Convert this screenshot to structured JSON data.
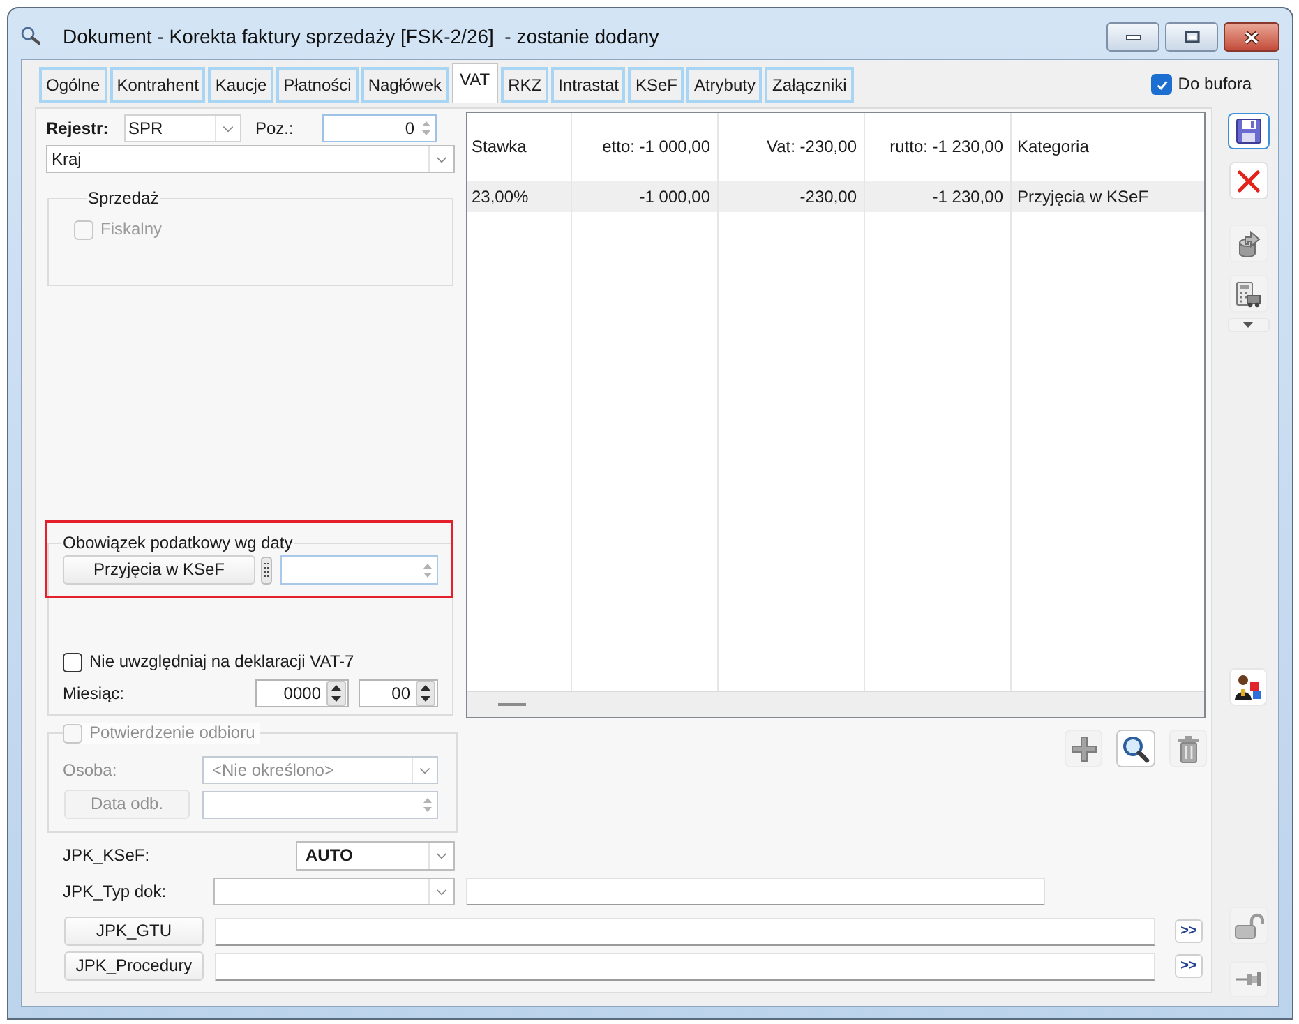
{
  "window": {
    "title": "Dokument - Korekta faktury sprzedaży [FSK-2/26]  - zostanie dodany"
  },
  "tabs": [
    {
      "label": "Ogólne",
      "selected": false
    },
    {
      "label": "Kontrahent",
      "selected": false
    },
    {
      "label": "Kaucje",
      "selected": false
    },
    {
      "label": "Płatności",
      "selected": false
    },
    {
      "label": "Nagłówek",
      "selected": false
    },
    {
      "label": "VAT",
      "selected": true
    },
    {
      "label": "RKZ",
      "selected": false
    },
    {
      "label": "Intrastat",
      "selected": false
    },
    {
      "label": "KSeF",
      "selected": false
    },
    {
      "label": "Atrybuty",
      "selected": false
    },
    {
      "label": "Załączniki",
      "selected": false
    }
  ],
  "do_bufora": {
    "label": "Do bufora",
    "checked": true
  },
  "rejestr": {
    "label": "Rejestr:",
    "value": "SPR"
  },
  "poz": {
    "label": "Poz.:",
    "value": "0"
  },
  "kraj": {
    "value": "Kraj"
  },
  "sprzedaz": {
    "title": "Sprzedaż",
    "fiskalny": {
      "label": "Fiskalny",
      "checked": false,
      "disabled": true
    }
  },
  "obowiazek_podatkowy": {
    "title": "Obowiązek podatkowy wg daty",
    "button": "Przyjęcia w KSeF",
    "highlighted": true
  },
  "pomin_vat7": {
    "label": "Nie uwzględniaj na deklaracji VAT-7",
    "checked": false
  },
  "miesiac": {
    "label": "Miesiąc:",
    "year": "0000",
    "month": "00"
  },
  "potwierdzenie_odbioru": {
    "label": "Potwierdzenie odbioru",
    "checked": false,
    "disabled": true,
    "osoba": {
      "label": "Osoba:",
      "value": "<Nie określono>",
      "disabled": true
    },
    "data_button": {
      "label": "Data odb.",
      "disabled": true
    }
  },
  "table": {
    "columns": [
      "Stawka",
      "etto: -1 000,00",
      "Vat: -230,00",
      "rutto: -1 230,00",
      "Kategoria"
    ],
    "rows": [
      {
        "cells": [
          "23,00%",
          "-1 000,00",
          "-230,00",
          "-1 230,00",
          "Przyjęcia w KSeF"
        ],
        "selected": true
      }
    ]
  },
  "jpk_ksef": {
    "label": "JPK_KSeF:",
    "value": "AUTO"
  },
  "jpk_typ_dok": {
    "label": "JPK_Typ dok:"
  },
  "jpk_gtu": {
    "button": "JPK_GTU",
    "more": ">>"
  },
  "jpk_procedury": {
    "button": "JPK_Procedury",
    "more": ">>"
  }
}
